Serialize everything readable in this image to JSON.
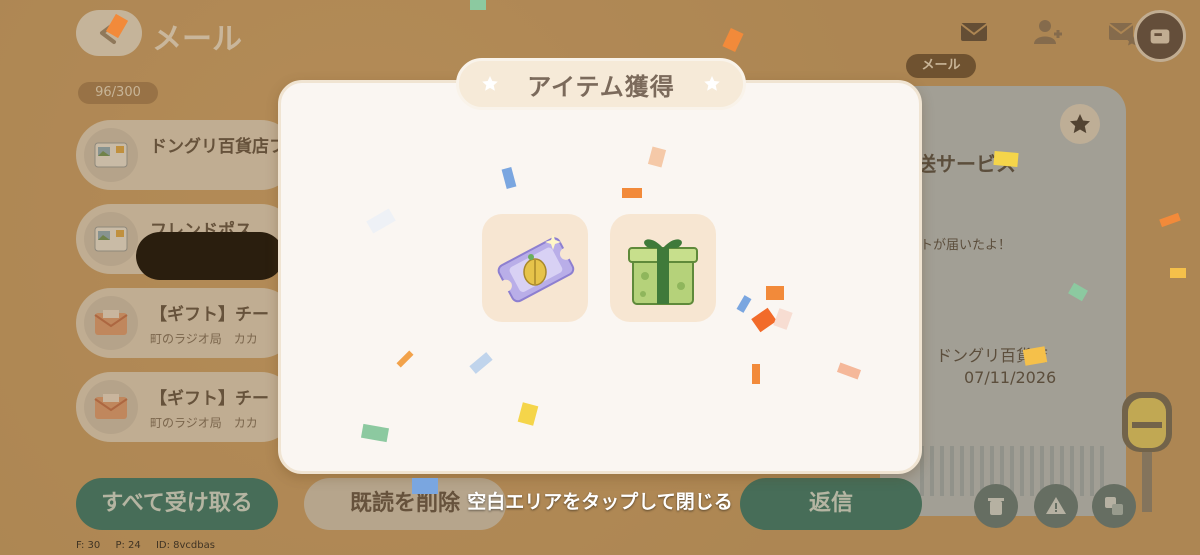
{
  "screen": {
    "title": "メール",
    "mail_count": "96/300",
    "active_tab_label": "メール"
  },
  "mail_list": [
    {
      "subject": "ドングリ百貨店フ",
      "sender": "",
      "icon": "postcard-icon"
    },
    {
      "subject": "フレンドポス",
      "sender": "",
      "icon": "postcard-icon"
    },
    {
      "subject": "【ギフト】チー",
      "sender": "町のラジオ局　カカ",
      "icon": "envelope-icon"
    },
    {
      "subject": "【ギフト】チー",
      "sender": "町のラジオ局　カカ",
      "icon": "envelope-icon"
    }
  ],
  "letter_preview": {
    "title": "送サービス",
    "body": "トが届いたよ！",
    "sender": "ドングリ百貨店",
    "date": "07/11/2026"
  },
  "buttons": {
    "receive_all": "すべて受け取る",
    "delete_read": "既読を削除",
    "reply": "返信"
  },
  "modal": {
    "title": "アイテム獲得",
    "items": [
      {
        "name": "ticket-icon"
      },
      {
        "name": "gift-box-icon"
      }
    ],
    "close_hint": "空白エリアをタップして閉じる"
  },
  "debug": {
    "fps": "F: 30",
    "ping": "P: 24",
    "id": "ID: 8vcdbas"
  },
  "colors": {
    "background": "#c9a06a",
    "modal_bg": "#faf6f2",
    "teal_button": "#2d7a72",
    "title_text": "#7b6a5b"
  }
}
